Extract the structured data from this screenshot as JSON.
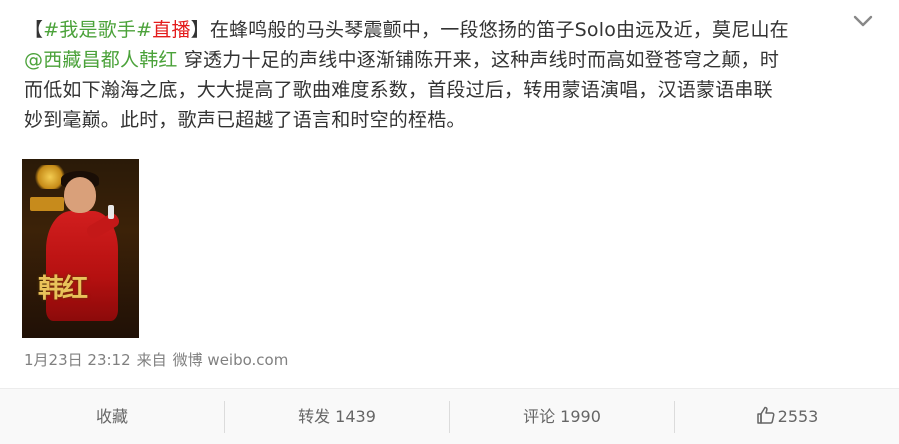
{
  "post": {
    "lines": [
      [
        {
          "t": "【",
          "c": "plain"
        },
        {
          "t": "#我是歌手#",
          "c": "hashtag"
        },
        {
          "t": "直播",
          "c": "red"
        },
        {
          "t": "】在蜂鸣般的马头琴震颤中，一段悠扬的笛子Solo由远及近，莫尼山在",
          "c": "plain"
        }
      ],
      [
        {
          "t": "@西藏昌都人韩红",
          "c": "green"
        },
        {
          "t": " 穿透力十足的声线中逐渐铺陈开来，这种声线时而高如登苍穹之颠，时",
          "c": "plain"
        }
      ],
      [
        {
          "t": "而低如下瀚海之底，大大提高了歌曲难度系数，首段过后，转用蒙语演唱，汉语蒙语串联",
          "c": "plain"
        }
      ],
      [
        {
          "t": "妙到毫巅。此时，歌声已超越了语言和时空的桎梏。",
          "c": "plain"
        }
      ]
    ],
    "image_caption": "韩红",
    "meta": {
      "time": "1月23日 23:12",
      "from": "来自",
      "source": "微博 weibo.com"
    }
  },
  "actions": {
    "favorite": "收藏",
    "repost": "转发 1439",
    "comment": "评论 1990",
    "like": "2553"
  },
  "icons": {
    "menu": "chevron-down-icon",
    "like": "thumbs-up-icon"
  },
  "colors": {
    "text": "#333333",
    "hashtag": "#4ba23a",
    "mention": "#4ba23a",
    "live": "#e31b1b",
    "meta": "#808080",
    "action_bar": "#f9f9f9"
  }
}
